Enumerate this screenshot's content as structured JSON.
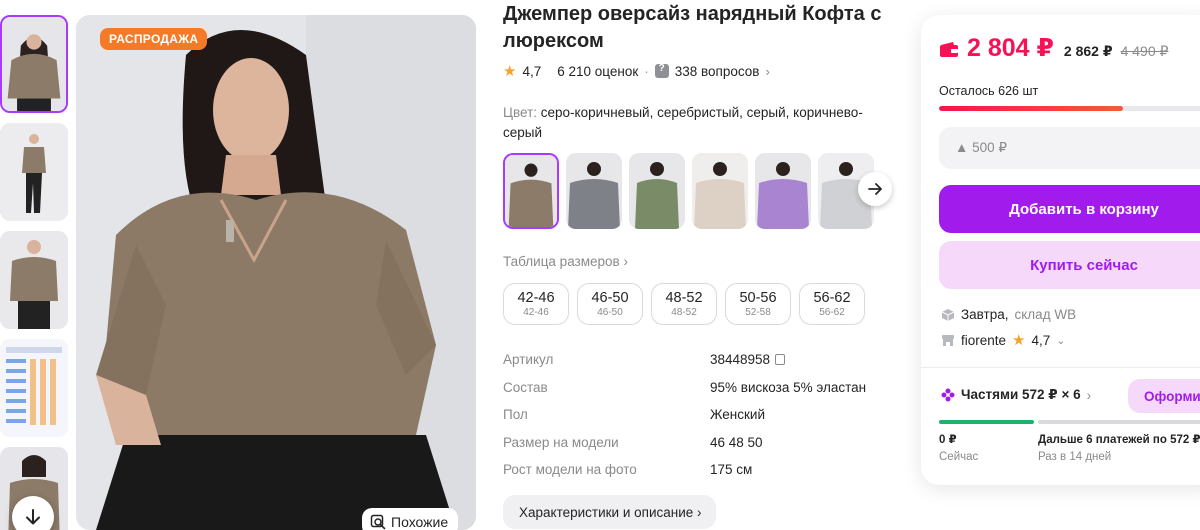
{
  "product": {
    "title": "Джемпер оверсайз нарядный Кофта с люрексом",
    "rating": "4,7",
    "reviews": "6 210 оценок",
    "questions": "338 вопросов",
    "color_label": "Цвет:",
    "color_value": "серо-коричневый, серебристый, серый, коричнево-серый",
    "sale_badge": "РАСПРОДАЖА",
    "similar_label": "Похожие",
    "size_table_label": "Таблица размеров ›",
    "sizes": [
      {
        "size": "42-46",
        "ru": "42-46"
      },
      {
        "size": "46-50",
        "ru": "46-50"
      },
      {
        "size": "48-52",
        "ru": "48-52"
      },
      {
        "size": "50-56",
        "ru": "52-58"
      },
      {
        "size": "56-62",
        "ru": "56-62"
      }
    ],
    "specs": [
      {
        "key": "Артикул",
        "value": "38448958"
      },
      {
        "key": "Состав",
        "value": "95% вискоза 5% эластан"
      },
      {
        "key": "Пол",
        "value": "Женский"
      },
      {
        "key": "Размер на модели",
        "value": "46 48 50"
      },
      {
        "key": "Рост модели на фото",
        "value": "175 см"
      }
    ],
    "characteristics_button": "Характеристики и описание ›"
  },
  "buy": {
    "price": "2 804 ₽",
    "price_alt": "2 862 ₽",
    "price_old": "4 490 ₽",
    "stock": "Осталось 626 шт",
    "stock_level": 0.68,
    "bonus": "▲ 500 ₽",
    "add_to_cart": "Добавить в корзину",
    "buy_now": "Купить сейчас",
    "delivery_main": "Завтра,",
    "delivery_muted": "склад WB",
    "seller_name": "fiorente",
    "seller_rating": "4,7",
    "installment": "Частями 572 ₽ × 6",
    "installment_button": "Оформи",
    "pay_now_amount": "0 ₽",
    "pay_now_label": "Сейчас",
    "pay_rest_amount": "Дальше 6 платежей по 572 ₽",
    "pay_rest_label": "Раз в 14 дней"
  },
  "colors": {
    "accent": "#a21bed",
    "price": "#f91155",
    "sale": "#f47a28"
  }
}
